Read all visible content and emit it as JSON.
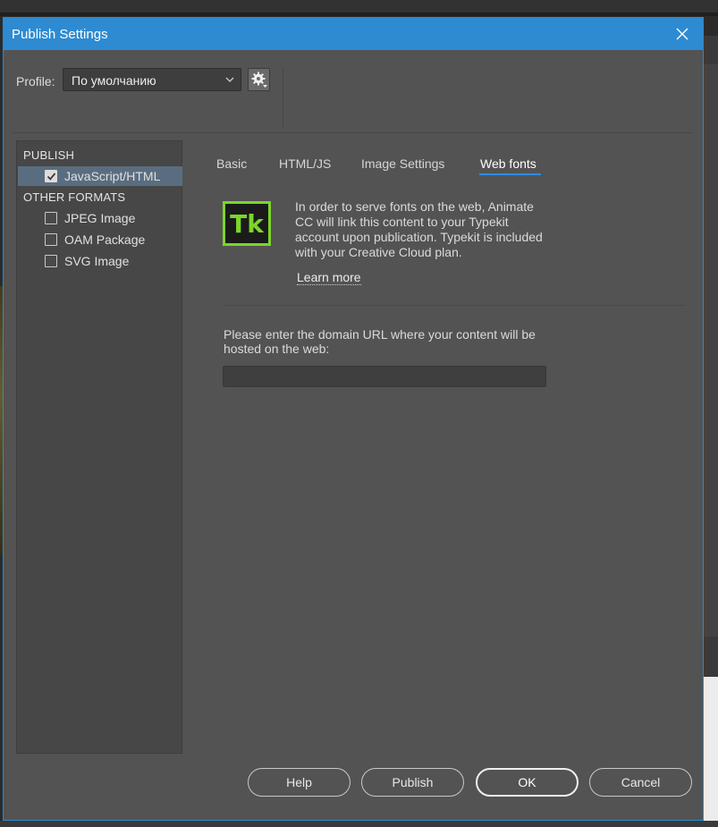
{
  "window": {
    "title": "Publish Settings"
  },
  "profile": {
    "label": "Profile:",
    "selected": "По умолчанию"
  },
  "left_panel": {
    "publish_header": "PUBLISH",
    "publish_items": [
      {
        "label": "JavaScript/HTML",
        "checked": true,
        "selected": true
      }
    ],
    "other_header": "OTHER FORMATS",
    "other_items": [
      {
        "label": "JPEG Image",
        "checked": false
      },
      {
        "label": "OAM Package",
        "checked": false
      },
      {
        "label": "SVG Image",
        "checked": false
      }
    ]
  },
  "tabs": [
    {
      "label": "Basic",
      "active": false
    },
    {
      "label": "HTML/JS",
      "active": false
    },
    {
      "label": "Image Settings",
      "active": false
    },
    {
      "label": "Web fonts",
      "active": true
    }
  ],
  "web_fonts": {
    "logo_text": "Tk",
    "info_text": "In order to serve fonts on the web, Animate CC will link this content to your Typekit account upon publication. Typekit is included with your Creative Cloud plan.",
    "learn_more": "Learn more",
    "domain_label": "Please enter the domain URL where your content will be hosted on the web:",
    "domain_value": ""
  },
  "buttons": {
    "help": "Help",
    "publish": "Publish",
    "ok": "OK",
    "cancel": "Cancel"
  },
  "colors": {
    "titlebar": "#2e8bd1",
    "dialog_bg": "#535353",
    "accent": "#2f8ce0",
    "typekit_green": "#7bd629"
  }
}
